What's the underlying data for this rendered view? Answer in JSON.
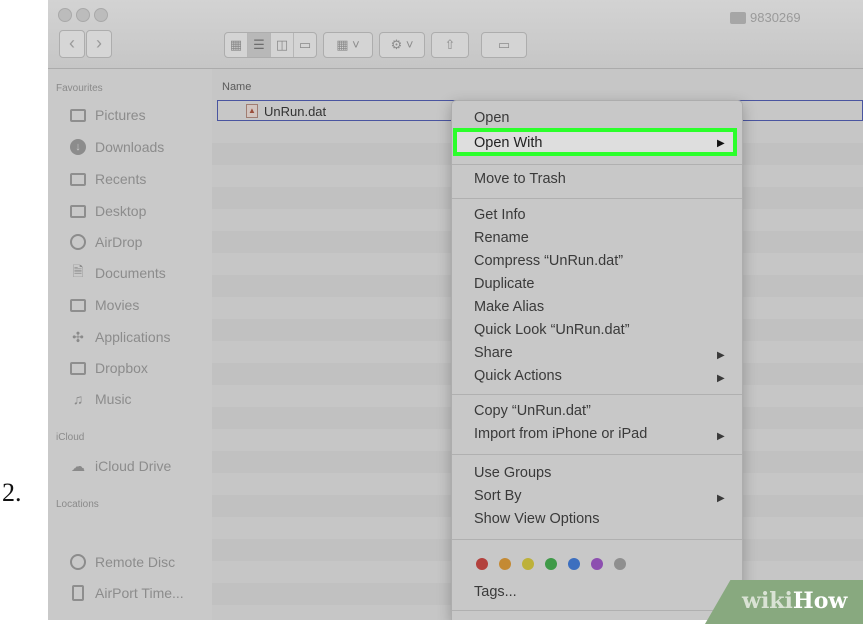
{
  "step": "2.",
  "window": {
    "title": "9830269"
  },
  "toolbar": {
    "back_icon": "chevron-left-icon",
    "forward_icon": "chevron-right-icon",
    "view_modes": [
      "icon-view-icon",
      "list-view-icon",
      "column-view-icon",
      "gallery-view-icon"
    ],
    "group_icon": "group-by-icon",
    "action_icon": "gear-icon",
    "share_icon": "share-icon",
    "tags_icon": "tag-icon"
  },
  "sidebar": {
    "favourites_heading": "Favourites",
    "favourites": [
      {
        "label": "Pictures",
        "icon": "camera-icon"
      },
      {
        "label": "Downloads",
        "icon": "download-icon"
      },
      {
        "label": "Recents",
        "icon": "clock-icon"
      },
      {
        "label": "Desktop",
        "icon": "desktop-icon"
      },
      {
        "label": "AirDrop",
        "icon": "airdrop-icon"
      },
      {
        "label": "Documents",
        "icon": "document-icon"
      },
      {
        "label": "Movies",
        "icon": "film-icon"
      },
      {
        "label": "Applications",
        "icon": "applications-icon"
      },
      {
        "label": "Dropbox",
        "icon": "folder-icon"
      },
      {
        "label": "Music",
        "icon": "music-icon"
      }
    ],
    "icloud_heading": "iCloud",
    "icloud": [
      {
        "label": "iCloud Drive",
        "icon": "cloud-icon"
      }
    ],
    "locations_heading": "Locations",
    "locations": [
      {
        "label": "Remote Disc",
        "icon": "disc-icon"
      },
      {
        "label": "AirPort Time...",
        "icon": "airport-icon"
      }
    ]
  },
  "list": {
    "column_name": "Name",
    "file": {
      "name": "UnRun.dat",
      "icon": "file-icon"
    }
  },
  "context_menu": {
    "open": "Open",
    "open_with": "Open With",
    "move_to_trash": "Move to Trash",
    "get_info": "Get Info",
    "rename": "Rename",
    "compress": "Compress “UnRun.dat”",
    "duplicate": "Duplicate",
    "make_alias": "Make Alias",
    "quick_look": "Quick Look “UnRun.dat”",
    "share": "Share",
    "quick_actions": "Quick Actions",
    "copy": "Copy “UnRun.dat”",
    "import": "Import from iPhone or iPad",
    "use_groups": "Use Groups",
    "sort_by": "Sort By",
    "show_view_options": "Show View Options",
    "tags": "Tags...",
    "submenu_arrow": "▶",
    "highlight_color": "#2bff2b",
    "tag_colors": [
      "#b3413d",
      "#c48a34",
      "#bdb13a",
      "#3f9a48",
      "#3d6fbf",
      "#8d4fb0",
      "#8f8f8f"
    ]
  },
  "watermark": {
    "part1": "wiki",
    "part2": "How"
  }
}
